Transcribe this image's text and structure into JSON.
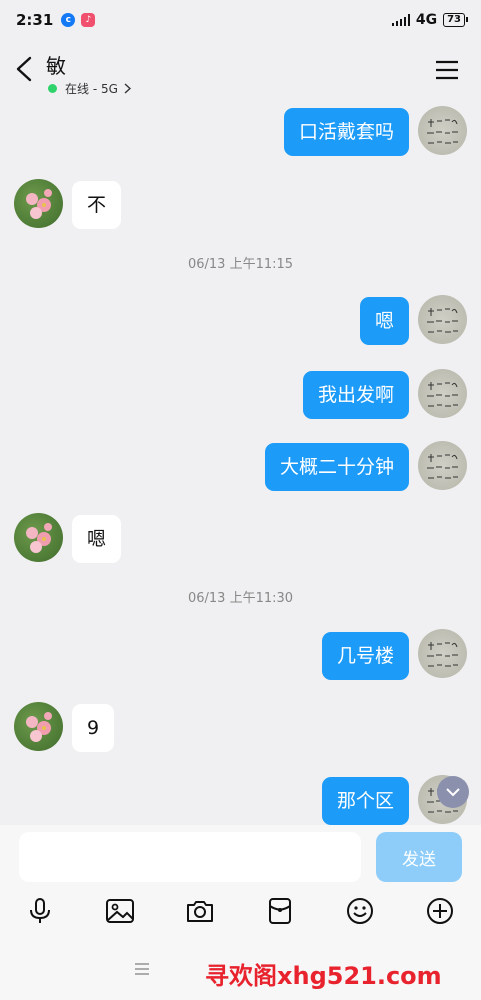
{
  "status_bar": {
    "time": "2:31",
    "network": "4G",
    "battery": "73"
  },
  "header": {
    "contact_name": "敏",
    "presence": "在线 - 5G"
  },
  "messages": [
    {
      "dir": "out",
      "text": "口活戴套吗"
    },
    {
      "dir": "in",
      "text": "不"
    },
    {
      "dir": "time",
      "text": "06/13 上午11:15"
    },
    {
      "dir": "out",
      "text": "嗯"
    },
    {
      "dir": "out",
      "text": "我出发啊"
    },
    {
      "dir": "out",
      "text": "大概二十分钟"
    },
    {
      "dir": "in",
      "text": "嗯"
    },
    {
      "dir": "time",
      "text": "06/13 上午11:30"
    },
    {
      "dir": "out",
      "text": "几号楼"
    },
    {
      "dir": "in",
      "text": "9"
    },
    {
      "dir": "out",
      "text": "那个区"
    }
  ],
  "input": {
    "value": "",
    "placeholder": "",
    "send_label": "发送"
  },
  "toolbar": {
    "icons": [
      "microphone-icon",
      "image-icon",
      "camera-icon",
      "red-packet-icon",
      "emoji-icon",
      "plus-icon"
    ]
  },
  "watermark": "寻欢阁xhg521.com",
  "colors": {
    "outgoing_bubble": "#1c9bf8",
    "send_button": "#8ecdfa",
    "online": "#2fd36c"
  }
}
